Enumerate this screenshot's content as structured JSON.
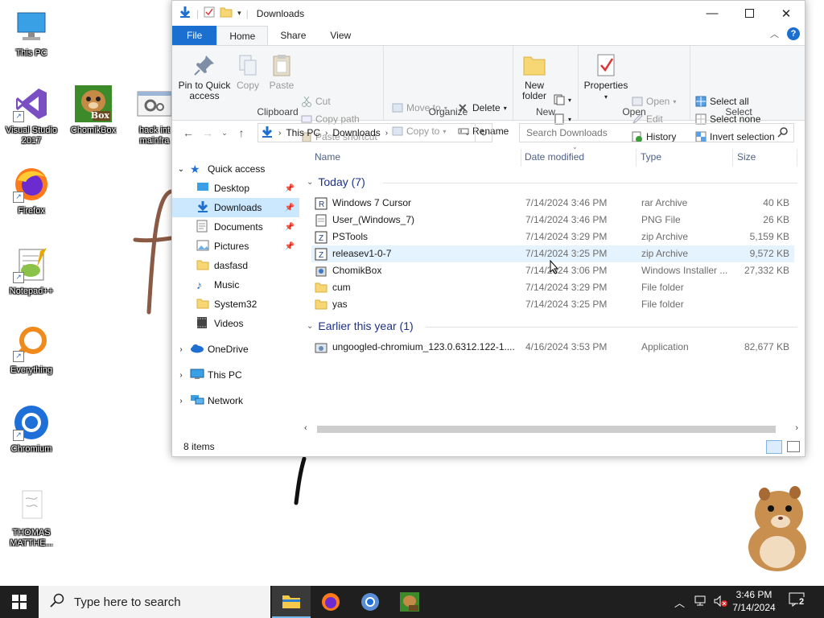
{
  "desktop": {
    "icons": [
      {
        "label": "This PC"
      },
      {
        "label": "Visual Studio 2017"
      },
      {
        "label": "ChomikBox"
      },
      {
        "label": "hack int mainfra"
      },
      {
        "label": "Firefox"
      },
      {
        "label": "Notepad++"
      },
      {
        "label": "Everything"
      },
      {
        "label": "Chromium"
      },
      {
        "label": "THOMAS MATTHE..."
      }
    ],
    "chomik_badge": "Box"
  },
  "window": {
    "title": "Downloads",
    "tabs": [
      "File",
      "Home",
      "Share",
      "View"
    ],
    "ribbon": {
      "clipboard": {
        "name": "Clipboard",
        "pin": "Pin to Quick access",
        "copy": "Copy",
        "paste": "Paste",
        "cut": "Cut",
        "copy_path": "Copy path",
        "paste_shortcut": "Paste shortcut"
      },
      "organize": {
        "name": "Organize",
        "move_to": "Move to",
        "copy_to": "Copy to",
        "delete": "Delete",
        "rename": "Rename"
      },
      "new": {
        "name": "New",
        "new_folder": "New folder"
      },
      "open": {
        "name": "Open",
        "properties": "Properties",
        "open": "Open",
        "edit": "Edit",
        "history": "History"
      },
      "select": {
        "name": "Select",
        "select_all": "Select all",
        "select_none": "Select none",
        "invert": "Invert selection"
      }
    },
    "address": {
      "parts": [
        "This PC",
        "Downloads"
      ]
    },
    "search": {
      "placeholder": "Search Downloads"
    },
    "nav": {
      "quick_access": "Quick access",
      "items": [
        "Desktop",
        "Downloads",
        "Documents",
        "Pictures",
        "dasfasd",
        "Music",
        "System32",
        "Videos"
      ],
      "onedrive": "OneDrive",
      "thispc": "This PC",
      "network": "Network"
    },
    "columns": [
      "Name",
      "Date modified",
      "Type",
      "Size"
    ],
    "groups": [
      {
        "label": "Today (7)",
        "files": [
          {
            "name": "Windows 7 Cursor",
            "date": "7/14/2024 3:46 PM",
            "type": "rar Archive",
            "size": "40 KB",
            "icon": "archive-r"
          },
          {
            "name": "User_(Windows_7)",
            "date": "7/14/2024 3:46 PM",
            "type": "PNG File",
            "size": "26 KB",
            "icon": "image"
          },
          {
            "name": "PSTools",
            "date": "7/14/2024 3:29 PM",
            "type": "zip Archive",
            "size": "5,159 KB",
            "icon": "archive-z"
          },
          {
            "name": "releasev1-0-7",
            "date": "7/14/2024 3:25 PM",
            "type": "zip Archive",
            "size": "9,572 KB",
            "icon": "archive-z"
          },
          {
            "name": "ChomikBox",
            "date": "7/14/2024 3:06 PM",
            "type": "Windows Installer ...",
            "size": "27,332 KB",
            "icon": "installer"
          },
          {
            "name": "cum",
            "date": "7/14/2024 3:29 PM",
            "type": "File folder",
            "size": "",
            "icon": "folder"
          },
          {
            "name": "yas",
            "date": "7/14/2024 3:25 PM",
            "type": "File folder",
            "size": "",
            "icon": "folder"
          }
        ]
      },
      {
        "label": "Earlier this year (1)",
        "files": [
          {
            "name": "ungoogled-chromium_123.0.6312.122-1....",
            "date": "4/16/2024 3:53 PM",
            "type": "Application",
            "size": "82,677 KB",
            "icon": "app"
          }
        ]
      }
    ],
    "status": "8 items"
  },
  "taskbar": {
    "search_placeholder": "Type here to search",
    "time": "3:46 PM",
    "date": "7/14/2024",
    "notification_count": "2"
  },
  "colors": {
    "accent": "#1a6fd0",
    "selection": "#cce8ff",
    "hover": "#e5f3ff",
    "taskbar": "#1f1f1f"
  }
}
